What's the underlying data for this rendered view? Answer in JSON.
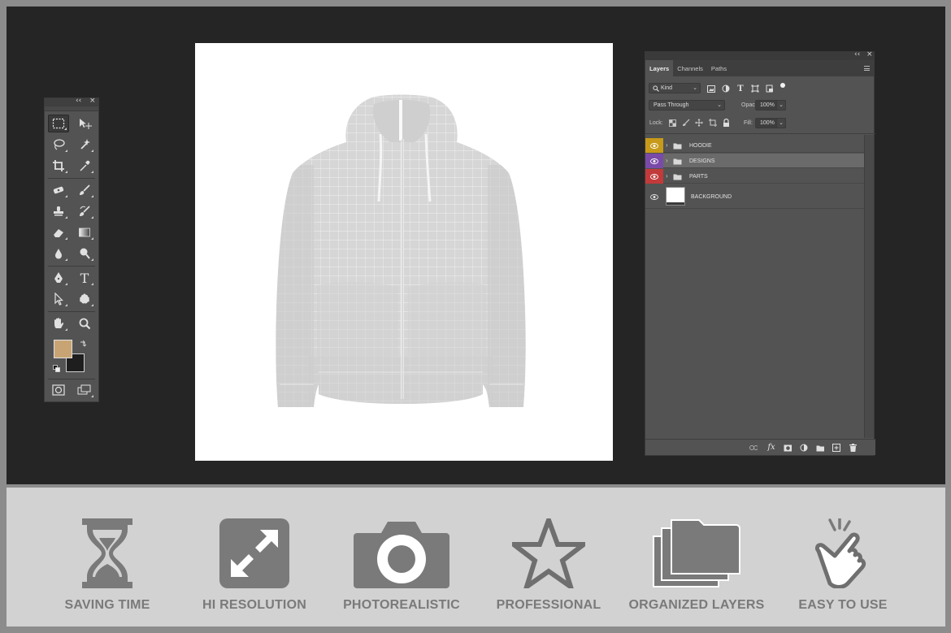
{
  "colors": {
    "workspace_bg": "#252525",
    "panel_bg": "#535353",
    "foreground_color": "#c8a474",
    "background_color": "#1e1e1e",
    "feature_icon": "#7a7a7a",
    "label_yellow": "#c79a1a",
    "label_purple": "#7a4aa8",
    "label_red": "#c23a3a"
  },
  "tools_panel": {
    "collapse_glyph": "‹‹",
    "close_glyph": "×",
    "tools": [
      "rectangular-marquee",
      "move",
      "lasso",
      "magic-wand",
      "crop",
      "eyedropper",
      "spot-healing",
      "brush",
      "clone-stamp",
      "history-brush",
      "eraser",
      "gradient",
      "blur",
      "dodge",
      "pen",
      "type",
      "path-selection",
      "custom-shape",
      "hand",
      "zoom"
    ],
    "type_glyph": "T"
  },
  "layers_panel": {
    "collapse_glyph": "‹‹",
    "close_glyph": "×",
    "tabs": [
      {
        "label": "Layers",
        "active": true
      },
      {
        "label": "Channels",
        "active": false
      },
      {
        "label": "Paths",
        "active": false
      }
    ],
    "filter_kind": "Kind",
    "blend_mode": "Pass Through",
    "opacity_label": "Opacity:",
    "opacity_value": "100%",
    "lock_label": "Lock:",
    "fill_label": "Fill:",
    "fill_value": "100%",
    "layers": [
      {
        "name": "HOODIE",
        "type": "group",
        "label_color": "#c79a1a",
        "selected": false
      },
      {
        "name": "DESIGNS",
        "type": "group",
        "label_color": "#7a4aa8",
        "selected": true
      },
      {
        "name": "PARTS",
        "type": "group",
        "label_color": "#c23a3a",
        "selected": false
      },
      {
        "name": "BACKGROUND",
        "type": "layer",
        "label_color": "",
        "selected": false
      }
    ],
    "bottom_fx": "fx"
  },
  "features": [
    {
      "label": "SAVING TIME",
      "icon": "hourglass-icon"
    },
    {
      "label": "HI RESOLUTION",
      "icon": "expand-arrows-icon"
    },
    {
      "label": "PHOTOREALISTIC",
      "icon": "camera-icon"
    },
    {
      "label": "PROFESSIONAL",
      "icon": "star-icon"
    },
    {
      "label": "ORGANIZED LAYERS",
      "icon": "stacked-layers-icon"
    },
    {
      "label": "EASY TO USE",
      "icon": "tap-hand-icon"
    }
  ]
}
